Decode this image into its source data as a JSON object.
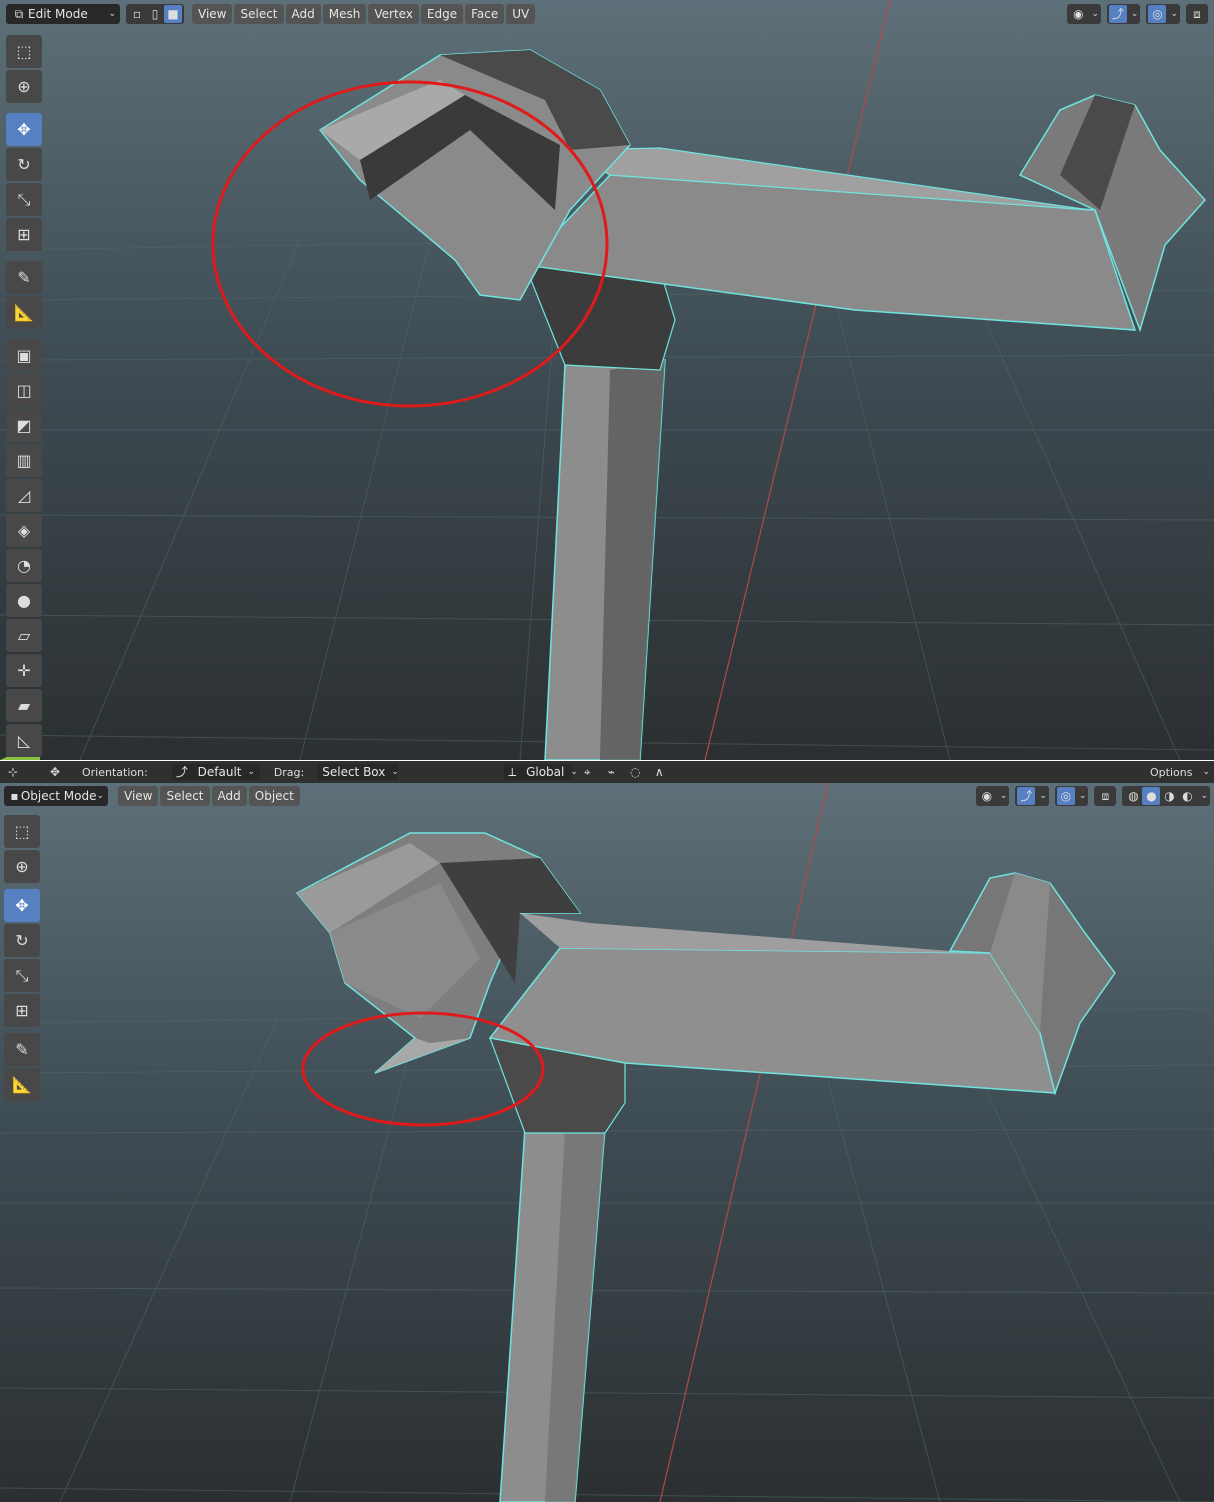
{
  "top": {
    "mode": "Edit Mode",
    "menus": [
      "View",
      "Select",
      "Add",
      "Mesh",
      "Vertex",
      "Edge",
      "Face",
      "UV"
    ],
    "select_modes": [
      "vertex-select-icon",
      "edge-select-icon",
      "face-select-icon"
    ],
    "right_icons": [
      "visibility-icon",
      "gizmo-icon",
      "overlay-icon",
      "xray-icon"
    ],
    "tools": [
      "select-box-icon",
      "cursor-icon",
      "move-icon",
      "rotate-icon",
      "scale-icon",
      "transform-icon",
      "annotate-icon",
      "measure-icon",
      "extrude-icon",
      "inset-icon",
      "bevel-icon",
      "loop-cut-icon",
      "knife-icon",
      "poly-build-icon",
      "spin-icon",
      "smooth-icon",
      "edge-slide-icon",
      "shrink-fatten-icon",
      "shear-icon",
      "rip-icon"
    ],
    "colors": {
      "bg": "#3d4a52",
      "grid": "#4a5a60",
      "wire": "#5ee6e0",
      "mesh": "#8a8a8a",
      "annotation": "#e01a1a",
      "active_tool": "#5680c2"
    }
  },
  "strip": {
    "orientation_label": "Orientation:",
    "orientation_value": "Default",
    "drag_label": "Drag:",
    "drag_value": "Select Box",
    "transform_space": "Global",
    "options": "Options"
  },
  "bottom": {
    "mode": "Object Mode",
    "menus": [
      "View",
      "Select",
      "Add",
      "Object"
    ],
    "tools": [
      "select-box-icon",
      "cursor-icon",
      "move-icon",
      "rotate-icon",
      "scale-icon",
      "transform-icon",
      "annotate-icon",
      "measure-icon"
    ]
  }
}
